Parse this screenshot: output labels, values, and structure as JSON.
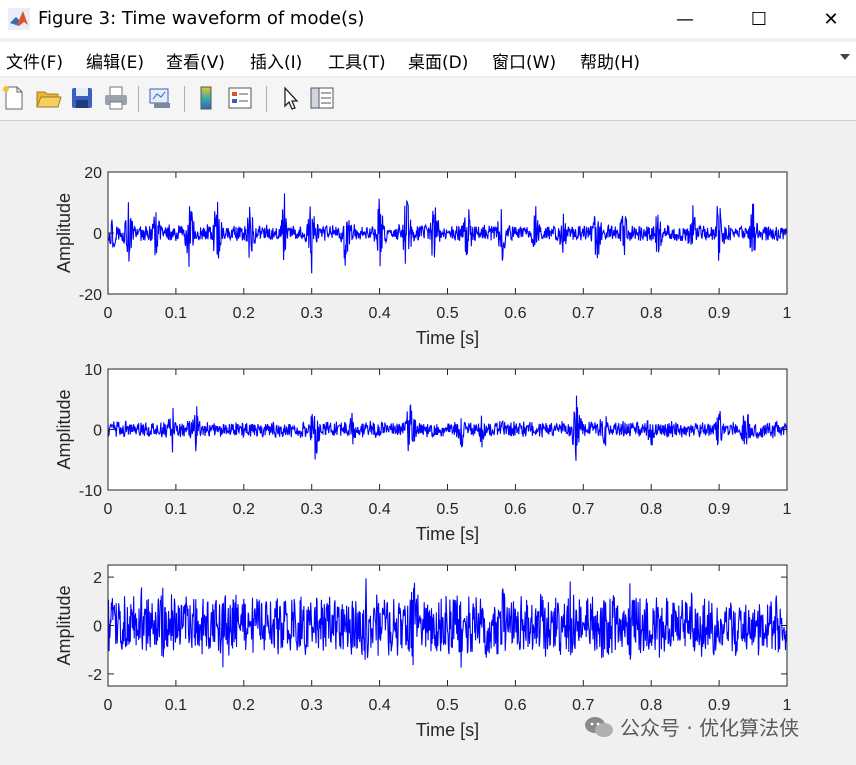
{
  "window": {
    "title": "Figure 3: Time waveform of mode(s)"
  },
  "window_controls": {
    "minimize": "—",
    "maximize": "☐",
    "close": "✕"
  },
  "menu": [
    "文件(F)",
    "编辑(E)",
    "查看(V)",
    "插入(I)",
    "工具(T)",
    "桌面(D)",
    "窗口(W)",
    "帮助(H)"
  ],
  "toolbar": [
    "new-file-icon",
    "open-folder-icon",
    "save-icon",
    "print-icon",
    "link-plot-icon",
    "colorbar-icon",
    "legend-icon",
    "pointer-icon",
    "property-editor-icon"
  ],
  "colors": {
    "series": "#0000ff",
    "axes": "#262626",
    "figure_bg": "#f0f0f0"
  },
  "watermark": {
    "text": "公众号 · 优化算法侠"
  },
  "chart_data": [
    {
      "type": "line",
      "xlabel": "Time [s]",
      "ylabel": "Amplitude",
      "xlim": [
        0,
        1
      ],
      "ylim": [
        -20,
        20
      ],
      "xticks": [
        "0",
        "0.1",
        "0.2",
        "0.3",
        "0.4",
        "0.5",
        "0.6",
        "0.7",
        "0.8",
        "0.9",
        "1"
      ],
      "yticks": [
        "20",
        "0",
        "-20"
      ],
      "grid": false,
      "series": [
        {
          "color": "#0000ff",
          "baseline_amplitude": 3,
          "impulse_times": [
            0.006,
            0.03,
            0.07,
            0.12,
            0.16,
            0.21,
            0.26,
            0.3,
            0.35,
            0.4,
            0.44,
            0.48,
            0.53,
            0.58,
            0.63,
            0.67,
            0.72,
            0.76,
            0.81,
            0.86,
            0.9,
            0.95
          ],
          "impulse_peaks": [
            8,
            12,
            10,
            14,
            14,
            12,
            13,
            14,
            13,
            13,
            15,
            14,
            12,
            11,
            10,
            11,
            12,
            10,
            10,
            12,
            15,
            11
          ]
        }
      ]
    },
    {
      "type": "line",
      "xlabel": "Time [s]",
      "ylabel": "Amplitude",
      "xlim": [
        0,
        1
      ],
      "ylim": [
        -10,
        10
      ],
      "xticks": [
        "0",
        "0.1",
        "0.2",
        "0.3",
        "0.4",
        "0.5",
        "0.6",
        "0.7",
        "0.8",
        "0.9",
        "1"
      ],
      "yticks": [
        "10",
        "0",
        "-10"
      ],
      "grid": false,
      "series": [
        {
          "color": "#0000ff",
          "baseline_amplitude": 1.5,
          "impulse_times": [
            0.095,
            0.13,
            0.305,
            0.36,
            0.445,
            0.52,
            0.55,
            0.69,
            0.73,
            0.8,
            0.9,
            0.94
          ],
          "impulse_peaks": [
            5.5,
            4.5,
            6.5,
            3.5,
            6.5,
            5.5,
            3.5,
            7,
            5,
            4,
            4,
            5.5
          ]
        }
      ]
    },
    {
      "type": "line",
      "xlabel": "Time [s]",
      "ylabel": "Amplitude",
      "xlim": [
        0,
        1
      ],
      "ylim": [
        -2.5,
        2.5
      ],
      "xticks": [
        "0",
        "0.1",
        "0.2",
        "0.3",
        "0.4",
        "0.5",
        "0.6",
        "0.7",
        "0.8",
        "0.9",
        "1"
      ],
      "yticks": [
        "2",
        "0",
        "-2"
      ],
      "grid": false,
      "series": [
        {
          "color": "#0000ff",
          "baseline_amplitude": 1.4,
          "impulse_times": [
            0.05,
            0.08,
            0.17,
            0.25,
            0.38,
            0.45,
            0.52,
            0.58,
            0.68,
            0.77,
            0.86
          ],
          "impulse_peaks": [
            2.3,
            2.2,
            2.2,
            2.1,
            2.3,
            2.5,
            2.2,
            2.1,
            2.2,
            2.3,
            2.1
          ]
        }
      ]
    }
  ]
}
